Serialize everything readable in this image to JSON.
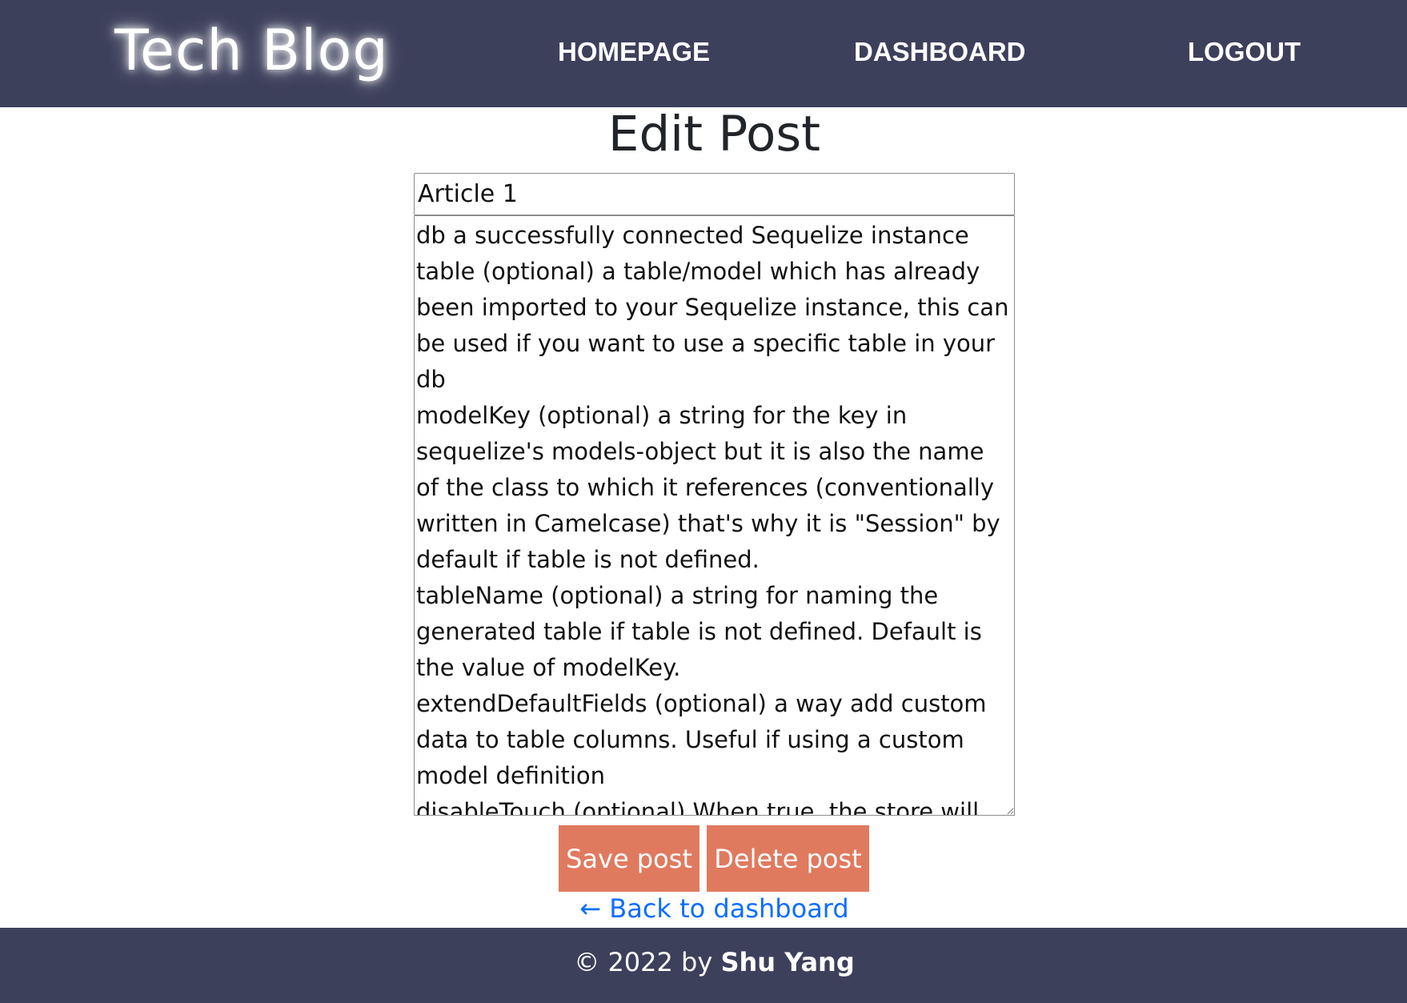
{
  "nav": {
    "brand": "Tech Blog",
    "links": [
      "HOMEPAGE",
      "DASHBOARD",
      "LOGOUT"
    ]
  },
  "page": {
    "title": "Edit Post"
  },
  "form": {
    "title_value": "Article 1",
    "content_value": "db a successfully connected Sequelize instance\ntable (optional) a table/model which has already been imported to your Sequelize instance, this can be used if you want to use a specific table in your db\nmodelKey (optional) a string for the key in sequelize's models-object but it is also the name of the class to which it references (conventionally written in Camelcase) that's why it is \"Session\" by default if table is not defined.\ntableName (optional) a string for naming the generated table if table is not defined. Default is the value of modelKey.\nextendDefaultFields (optional) a way add custom data to table columns. Useful if using a custom model definition\ndisableTouch (optional) When true, the store will",
    "save_label": "Save post",
    "delete_label": "Delete post",
    "back_label": "← Back to dashboard"
  },
  "footer": {
    "prefix": "© 2022 by ",
    "author": "Shu Yang"
  },
  "colors": {
    "navbar": "#3d405b",
    "button": "#e07a5f",
    "link": "#0d6efd"
  }
}
